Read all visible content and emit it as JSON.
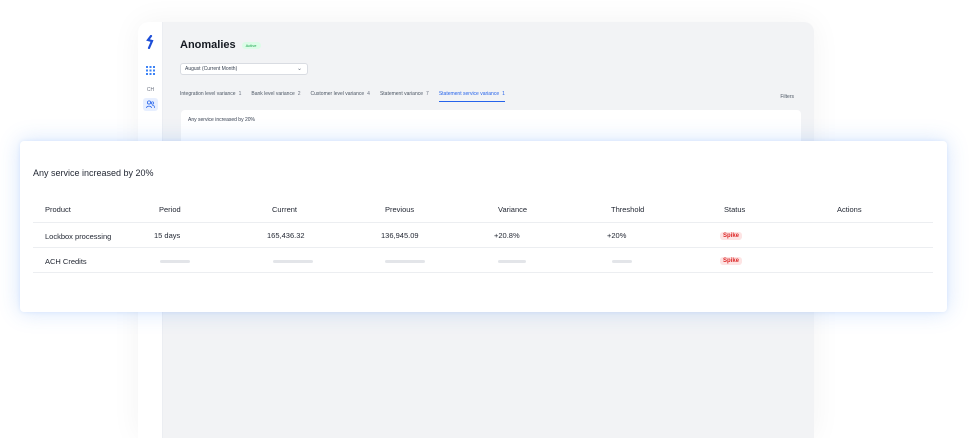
{
  "page": {
    "title": "Anomalies",
    "status_badge": "Active",
    "month_select": "August (Current Month)",
    "filters_label": "Filters",
    "inner_card_title": "Any service increased by 20%"
  },
  "rail": {
    "logo": "logo-icon",
    "apps": "grid-icon",
    "ch_label": "CH",
    "users": "users-icon"
  },
  "tabs": [
    {
      "label": "Integration level variance",
      "count": "1"
    },
    {
      "label": "Bank level variance",
      "count": "2"
    },
    {
      "label": "Customer level variance",
      "count": "4"
    },
    {
      "label": "Statement variance",
      "count": "7"
    },
    {
      "label": "Statement service variance",
      "count": "1",
      "active": true
    }
  ],
  "card": {
    "title": "Any service increased by 20%",
    "columns": [
      "Product",
      "Period",
      "Current",
      "Previous",
      "Variance",
      "Threshold",
      "Status",
      "Actions"
    ],
    "rows": [
      {
        "product": "Lockbox processing",
        "period": "15 days",
        "current": "165,436.32",
        "previous": "136,945.09",
        "variance": "+20.8%",
        "threshold": "+20%",
        "status": "Spike"
      },
      {
        "product": "ACH Credits",
        "period": "",
        "current": "",
        "previous": "",
        "variance": "",
        "threshold": "",
        "status": "Spike"
      }
    ]
  },
  "colors": {
    "accent": "#2563eb",
    "link": "#1d6fc8",
    "spike": "#dc2626",
    "active_badge": "#16a34a"
  }
}
